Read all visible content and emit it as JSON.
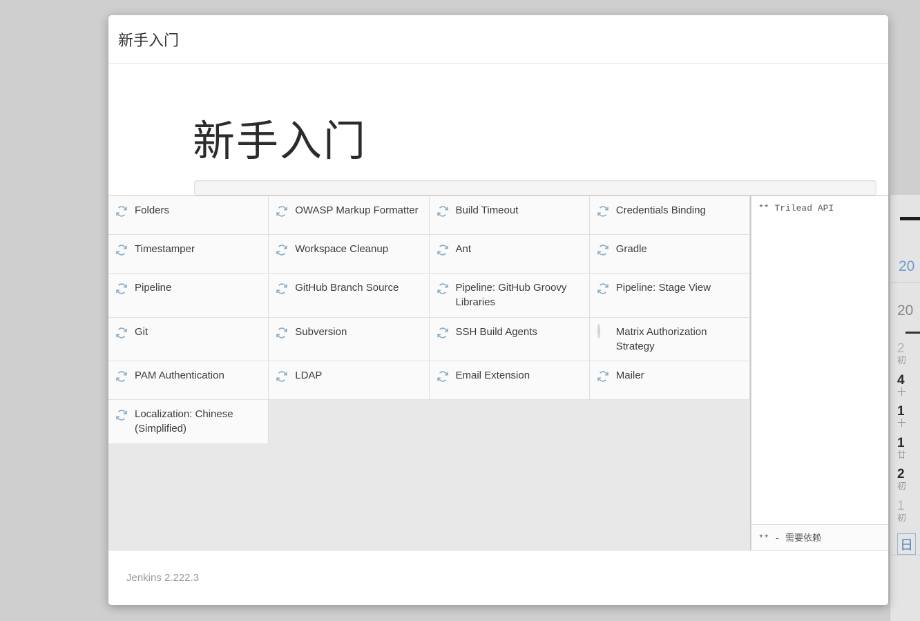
{
  "window": {
    "titlebar_text": "新手入门",
    "hero_title": "新手入门",
    "footer_text": "Jenkins 2.222.3"
  },
  "progress": {
    "percent": 0,
    "value_label": ""
  },
  "plugins": {
    "columns": 4,
    "items": [
      {
        "label": "Folders",
        "status": "installing",
        "icon": "sync-icon"
      },
      {
        "label": "OWASP Markup Formatter",
        "status": "installing",
        "icon": "sync-icon"
      },
      {
        "label": "Build Timeout",
        "status": "installing",
        "icon": "sync-icon"
      },
      {
        "label": "Credentials Binding",
        "status": "installing",
        "icon": "sync-icon"
      },
      {
        "label": "Timestamper",
        "status": "installing",
        "icon": "sync-icon"
      },
      {
        "label": "Workspace Cleanup",
        "status": "installing",
        "icon": "sync-icon"
      },
      {
        "label": "Ant",
        "status": "installing",
        "icon": "sync-icon"
      },
      {
        "label": "Gradle",
        "status": "installing",
        "icon": "sync-icon"
      },
      {
        "label": "Pipeline",
        "status": "installing",
        "icon": "sync-icon"
      },
      {
        "label": "GitHub Branch Source",
        "status": "installing",
        "icon": "sync-icon"
      },
      {
        "label": "Pipeline: GitHub Groovy Libraries",
        "status": "installing",
        "icon": "sync-icon"
      },
      {
        "label": "Pipeline: Stage View",
        "status": "installing",
        "icon": "sync-icon"
      },
      {
        "label": "Git",
        "status": "installing",
        "icon": "sync-icon"
      },
      {
        "label": "Subversion",
        "status": "installing",
        "icon": "sync-icon"
      },
      {
        "label": "SSH Build Agents",
        "status": "installing",
        "icon": "sync-icon"
      },
      {
        "label": "Matrix Authorization Strategy",
        "status": "pending",
        "icon": "pending-circle-icon"
      },
      {
        "label": "PAM Authentication",
        "status": "installing",
        "icon": "sync-icon"
      },
      {
        "label": "LDAP",
        "status": "installing",
        "icon": "sync-icon"
      },
      {
        "label": "Email Extension",
        "status": "installing",
        "icon": "sync-icon"
      },
      {
        "label": "Mailer",
        "status": "installing",
        "icon": "sync-icon"
      },
      {
        "label": "Localization: Chinese (Simplified)",
        "status": "installing",
        "icon": "sync-icon"
      }
    ]
  },
  "log": {
    "lines": [
      "** Trilead API"
    ],
    "footer_note": "** - 需要依赖"
  },
  "right_panel": {
    "year_blue": "20",
    "year_grey": "20",
    "days": [
      {
        "num": "2",
        "lunar": "初",
        "dim": true
      },
      {
        "num": "4",
        "lunar": "十",
        "dim": false
      },
      {
        "num": "1",
        "lunar": "十",
        "dim": false
      },
      {
        "num": "1",
        "lunar": "廿",
        "dim": false
      },
      {
        "num": "2",
        "lunar": "初",
        "dim": false
      },
      {
        "num": "1",
        "lunar": "初",
        "dim": true
      }
    ],
    "footer_label": "日"
  },
  "colors": {
    "accent": "#4a90d9",
    "sync_icon": "#8fadc4",
    "page_background": "#cfcfcf",
    "grid_background": "#e8e8e8",
    "cell_background": "#fafafa"
  }
}
